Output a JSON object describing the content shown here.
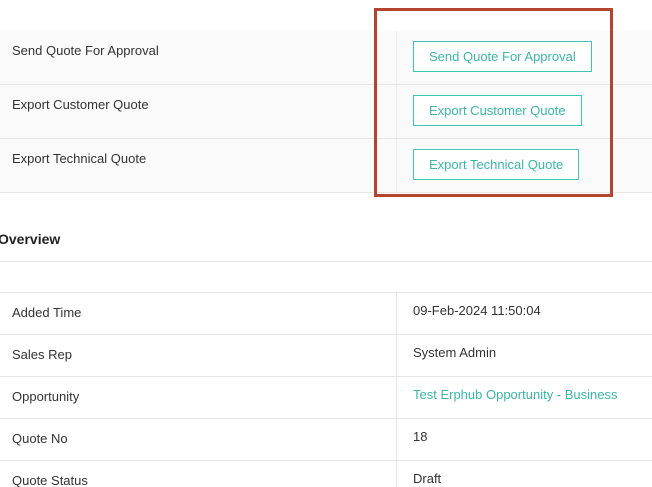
{
  "actions": [
    {
      "label": "Send Quote For Approval",
      "button": "Send Quote For Approval"
    },
    {
      "label": "Export Customer Quote",
      "button": "Export Customer Quote"
    },
    {
      "label": "Export Technical Quote",
      "button": "Export Technical Quote"
    }
  ],
  "overview": {
    "title": "Overview",
    "rows": [
      {
        "label": "Added Time",
        "value": "09-Feb-2024 11:50:04"
      },
      {
        "label": "Sales Rep",
        "value": "System Admin"
      },
      {
        "label": "Opportunity",
        "value": "Test Erphub Opportunity - Business"
      },
      {
        "label": "Quote No",
        "value": "18"
      },
      {
        "label": "Quote Status",
        "value": "Draft"
      }
    ]
  },
  "colors": {
    "accent": "#3ab7a6",
    "highlight": "#b5442f",
    "row_bg": "#fafafa",
    "border": "#e6e6e6"
  }
}
